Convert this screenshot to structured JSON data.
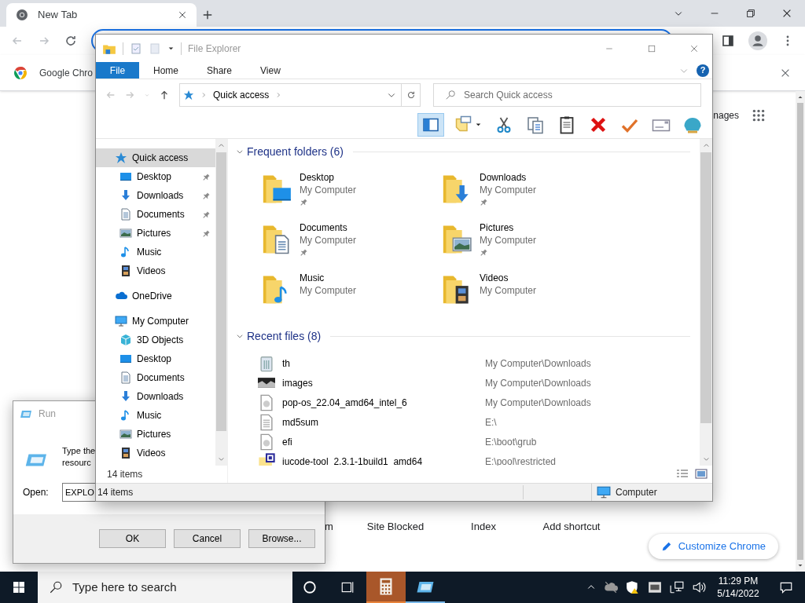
{
  "browser": {
    "tabs": [
      {
        "title": "New Tab",
        "selected": true
      }
    ],
    "banner": {
      "text": "Google Chro"
    },
    "top_link": "nages",
    "shortcuts": [
      {
        "label": "m"
      },
      {
        "label": "Site Blocked"
      },
      {
        "label": "Index"
      },
      {
        "label": "Add shortcut"
      }
    ],
    "customize_button": "Customize Chrome"
  },
  "run_dialog": {
    "title": "Run",
    "description_lines": [
      "Type the",
      "resourc"
    ],
    "open_label": "Open:",
    "open_value": "EXPLO",
    "buttons": [
      "OK",
      "Cancel",
      "Browse..."
    ]
  },
  "explorer": {
    "title": "File Explorer",
    "ribbon_tabs": [
      {
        "label": "File",
        "selected": true
      },
      {
        "label": "Home",
        "selected": false
      },
      {
        "label": "Share",
        "selected": false
      },
      {
        "label": "View",
        "selected": false
      }
    ],
    "help": "?",
    "breadcrumb": "Quick access",
    "search": {
      "placeholder": "Search Quick access"
    },
    "toolbar": [
      {
        "kind": "pane",
        "pressed": true
      },
      {
        "kind": "note",
        "pressed": false
      },
      {
        "kind": "cut",
        "pressed": false
      },
      {
        "kind": "copy",
        "pressed": false
      },
      {
        "kind": "paste",
        "pressed": false
      },
      {
        "kind": "delete",
        "pressed": false
      },
      {
        "kind": "check",
        "pressed": false
      },
      {
        "kind": "mail",
        "pressed": false
      },
      {
        "kind": "shell",
        "pressed": false
      }
    ],
    "nav": [
      {
        "label": "Quick access",
        "kind": "star",
        "selected": true,
        "children": [
          {
            "label": "Desktop",
            "kind": "desktop",
            "selected": false,
            "pinned": true
          },
          {
            "label": "Downloads",
            "kind": "downloads",
            "selected": false,
            "pinned": true
          },
          {
            "label": "Documents",
            "kind": "documents",
            "selected": false,
            "pinned": true
          },
          {
            "label": "Pictures",
            "kind": "pictures",
            "selected": false,
            "pinned": true
          },
          {
            "label": "Music",
            "kind": "music",
            "selected": false,
            "pinned": false
          },
          {
            "label": "Videos",
            "kind": "videos",
            "selected": false,
            "pinned": false
          }
        ]
      },
      {
        "label": "OneDrive",
        "kind": "cloud",
        "selected": false
      },
      {
        "label": "My Computer",
        "kind": "computer",
        "selected": false,
        "children": [
          {
            "label": "3D Objects",
            "kind": "cube",
            "selected": false
          },
          {
            "label": "Desktop",
            "kind": "desktop",
            "selected": false
          },
          {
            "label": "Documents",
            "kind": "documents",
            "selected": false
          },
          {
            "label": "Downloads",
            "kind": "downloads",
            "selected": false
          },
          {
            "label": "Music",
            "kind": "music",
            "selected": false
          },
          {
            "label": "Pictures",
            "kind": "pictures",
            "selected": false
          },
          {
            "label": "Videos",
            "kind": "videos",
            "selected": false
          }
        ]
      }
    ],
    "nav_footer": "14 items",
    "frequent": {
      "heading": "Frequent folders (6)",
      "folders": [
        {
          "name": "Desktop",
          "location": "My Computer",
          "kind": "desktop",
          "pinned": true
        },
        {
          "name": "Downloads",
          "location": "My Computer",
          "kind": "downloads",
          "pinned": true
        },
        {
          "name": "Documents",
          "location": "My Computer",
          "kind": "documents",
          "pinned": true
        },
        {
          "name": "Pictures",
          "location": "My Computer",
          "kind": "pictures",
          "pinned": true
        },
        {
          "name": "Music",
          "location": "My Computer",
          "kind": "music",
          "pinned": false
        },
        {
          "name": "Videos",
          "location": "My Computer",
          "kind": "videos",
          "pinned": false
        }
      ]
    },
    "recent": {
      "heading": "Recent files (8)",
      "files": [
        {
          "name": "th",
          "location": "My Computer\\Downloads",
          "kind": "bin"
        },
        {
          "name": "images",
          "location": "My Computer\\Downloads",
          "kind": "photo"
        },
        {
          "name": "pop-os_22.04_amd64_intel_6",
          "location": "My Computer\\Downloads",
          "kind": "disc"
        },
        {
          "name": "md5sum",
          "location": "E:\\",
          "kind": "text"
        },
        {
          "name": "efi",
          "location": "E:\\boot\\grub",
          "kind": "disc"
        },
        {
          "name": "iucode-tool_2.3.1-1build1_amd64",
          "location": "E:\\pool\\restricted",
          "kind": "package"
        }
      ]
    },
    "status": "14 items",
    "status_location": "Computer"
  },
  "taskbar": {
    "search": {
      "placeholder": "Type here to search"
    },
    "apps": [
      {
        "kind": "calculator",
        "active": true
      },
      {
        "kind": "run",
        "active": false
      }
    ],
    "time": "11:29 PM",
    "date": "5/14/2022"
  }
}
